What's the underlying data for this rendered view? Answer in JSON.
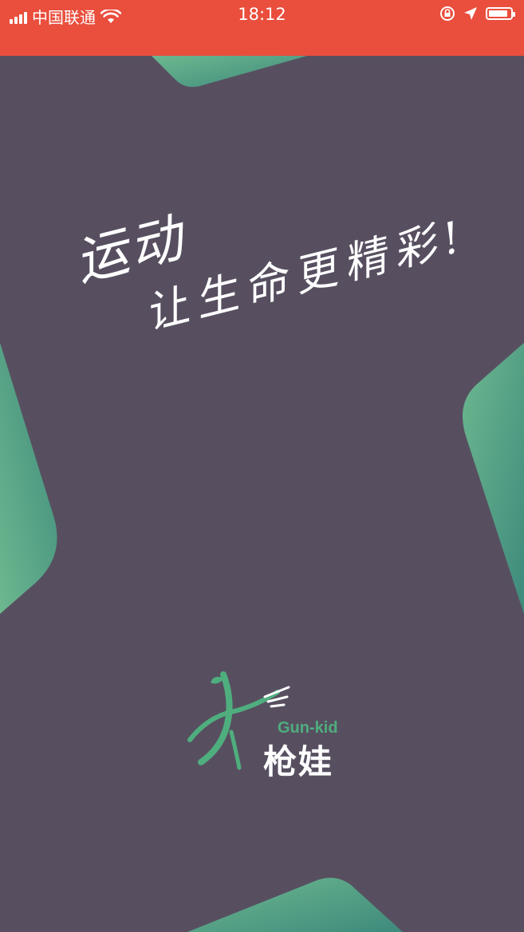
{
  "status_bar": {
    "carrier": "中国联通",
    "time": "18:12",
    "battery_level": 0.9
  },
  "slogan": {
    "line1": "运动",
    "line2": "让生命更精彩!"
  },
  "logo": {
    "english": "Gun-kid",
    "chinese": "枪娃"
  },
  "colors": {
    "status_bar": "#ea4e3d",
    "background": "#574f60",
    "accent_green": "#4fae7e"
  }
}
